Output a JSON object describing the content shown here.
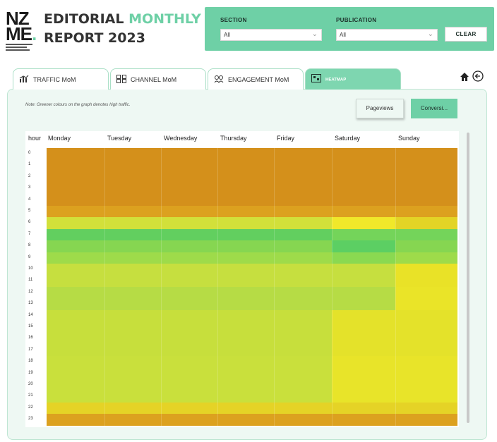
{
  "logo": {
    "line1": "NZ",
    "line2": "ME",
    "dot": "."
  },
  "title": {
    "part1": "EDITORIAL ",
    "accent": "MONTHLY",
    "part2": "REPORT 2023"
  },
  "filters": {
    "section": {
      "label": "SECTION",
      "value": "All"
    },
    "publication": {
      "label": "PUBLICATION",
      "value": "All"
    },
    "clear_label": "CLEAR"
  },
  "tabs": [
    {
      "label": "TRAFFIC MoM",
      "icon": "chart-icon"
    },
    {
      "label": "CHANNEL MoM",
      "icon": "channel-icon"
    },
    {
      "label": "ENGAGEMENT MoM",
      "icon": "engagement-icon"
    },
    {
      "label": "HEATMAP",
      "icon": "heatmap-icon",
      "active": true
    }
  ],
  "nav": {
    "home_icon": "home-icon",
    "back_icon": "back-arrow-icon"
  },
  "note": "Note: Greener colours on the graph denotes high traffic.",
  "buttons": {
    "pageviews": "Pageviews",
    "conversions": "Conversi..."
  },
  "heatmap": {
    "hour_header": "hour",
    "days": [
      "Monday",
      "Tuesday",
      "Wednesday",
      "Thursday",
      "Friday",
      "Saturday",
      "Sunday"
    ],
    "hours": [
      "0",
      "1",
      "2",
      "3",
      "4",
      "5",
      "6",
      "7",
      "8",
      "9",
      "10",
      "11",
      "12",
      "13",
      "14",
      "15",
      "16",
      "17",
      "18",
      "19",
      "20",
      "21",
      "22",
      "23"
    ],
    "colors": {
      "orange_dark": "#d4901b",
      "orange": "#dca11f",
      "yellow": "#e9e227",
      "green": "#5ccf63",
      "accent": "#6ed0a6"
    }
  }
}
